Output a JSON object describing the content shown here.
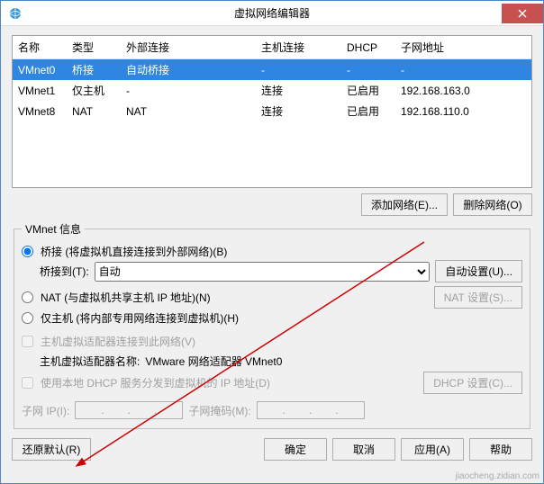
{
  "window": {
    "title": "虚拟网络编辑器"
  },
  "table": {
    "headers": {
      "name": "名称",
      "type": "类型",
      "external": "外部连接",
      "host": "主机连接",
      "dhcp": "DHCP",
      "subnet": "子网地址"
    },
    "rows": [
      {
        "name": "VMnet0",
        "type": "桥接",
        "external": "自动桥接",
        "host": "-",
        "dhcp": "-",
        "subnet": "-",
        "selected": true
      },
      {
        "name": "VMnet1",
        "type": "仅主机",
        "external": "-",
        "host": "连接",
        "dhcp": "已启用",
        "subnet": "192.168.163.0",
        "selected": false
      },
      {
        "name": "VMnet8",
        "type": "NAT",
        "external": "NAT",
        "host": "连接",
        "dhcp": "已启用",
        "subnet": "192.168.110.0",
        "selected": false
      }
    ]
  },
  "buttons": {
    "add_network": "添加网络(E)...",
    "remove_network": "删除网络(O)",
    "auto_settings": "自动设置(U)...",
    "nat_settings": "NAT 设置(S)...",
    "dhcp_settings": "DHCP 设置(C)...",
    "restore_defaults": "还原默认(R)",
    "ok": "确定",
    "cancel": "取消",
    "apply": "应用(A)",
    "help": "帮助"
  },
  "vmnet_info": {
    "legend": "VMnet 信息",
    "bridge_radio": "桥接 (将虚拟机直接连接到外部网络)(B)",
    "bridge_to_label": "桥接到(T):",
    "bridge_to_value": "自动",
    "nat_radio": "NAT (与虚拟机共享主机 IP 地址)(N)",
    "hostonly_radio": "仅主机 (将内部专用网络连接到虚拟机)(H)",
    "host_adapter_check": "主机虚拟适配器连接到此网络(V)",
    "host_adapter_name_label": "主机虚拟适配器名称:",
    "host_adapter_name_value": "VMware 网络适配器 VMnet0",
    "dhcp_check": "使用本地 DHCP 服务分发到虚拟机的 IP 地址(D)",
    "subnet_ip_label": "子网 IP(I):",
    "subnet_mask_label": "子网掩码(M):"
  },
  "watermark": "jiaocheng.zidian.com"
}
